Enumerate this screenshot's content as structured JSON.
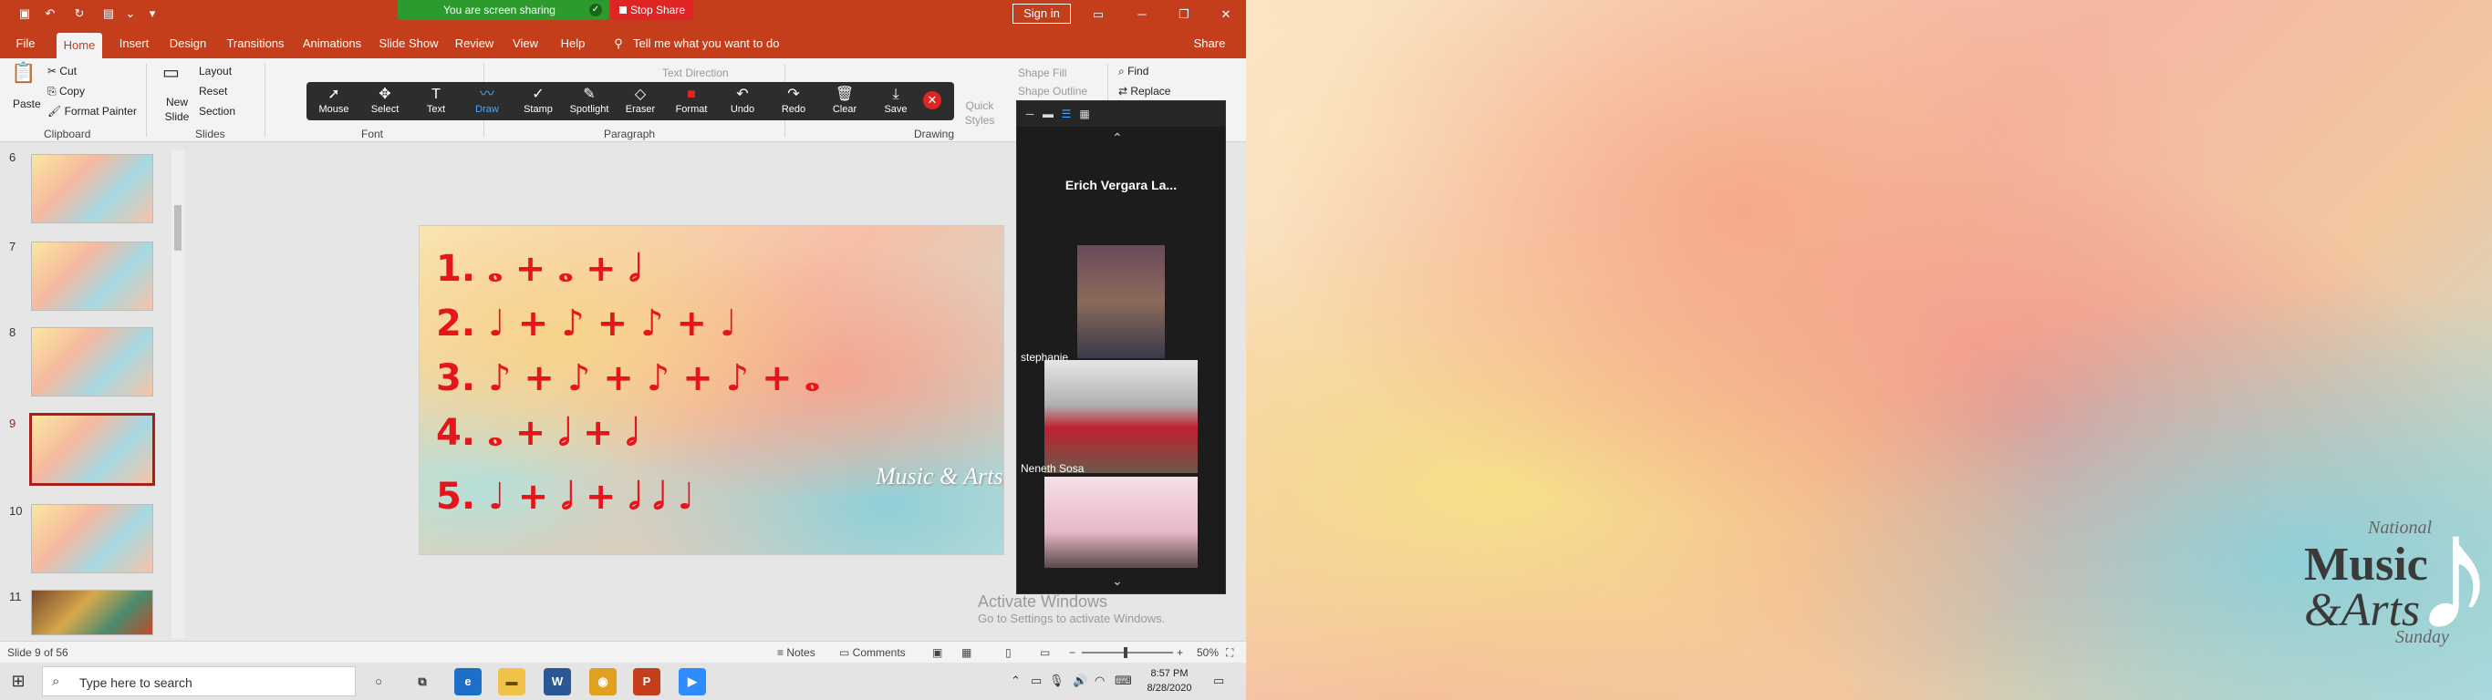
{
  "titlebar": {
    "sharing_text": "You are screen sharing",
    "stop_share": "Stop Share",
    "sign_in": "Sign in"
  },
  "tabs": {
    "file": "File",
    "home": "Home",
    "insert": "Insert",
    "design": "Design",
    "transitions": "Transitions",
    "animations": "Animations",
    "slideshow": "Slide Show",
    "review": "Review",
    "view": "View",
    "help": "Help",
    "tell_me": "Tell me what you want to do",
    "share": "Share"
  },
  "ribbon": {
    "paste": "Paste",
    "cut": "Cut",
    "copy": "Copy",
    "format_painter": "Format Painter",
    "clipboard": "Clipboard",
    "new_slide": "New Slide",
    "layout": "Layout",
    "reset": "Reset",
    "section": "Section",
    "slides": "Slides",
    "font": "Font",
    "paragraph": "Paragraph",
    "drawing": "Drawing",
    "text_direction": "Text Direction",
    "shape_fill": "Shape Fill",
    "shape_outline": "Shape Outline",
    "quick_styles": "Quick Styles",
    "find": "Find",
    "replace": "Replace"
  },
  "annotate": {
    "tools": [
      "Mouse",
      "Select",
      "Text",
      "Draw",
      "Stamp",
      "Spotlight",
      "Eraser",
      "Format",
      "Undo",
      "Redo",
      "Clear",
      "Save"
    ]
  },
  "thumbnails": {
    "numbers": [
      "6",
      "7",
      "8",
      "9",
      "10",
      "11"
    ]
  },
  "slide": {
    "rows": [
      "1.  𝅝 + 𝅝 + 𝅗𝅥",
      "2.  ♩ + ♪ + ♪ + ♩",
      "3.  ♪ + ♪ + ♪ + ♪ + 𝅝",
      "4.  𝅝 + 𝅗𝅥 + 𝅗𝅥",
      "5.  ♩ + 𝅗𝅥 + 𝅗𝅥 𝅗𝅥 ♩"
    ],
    "logo": "Music & Arts"
  },
  "activate": {
    "line1": "Activate Windows",
    "line2": "Go to Settings to activate Windows."
  },
  "zoom": {
    "host_name": "Erich  Vergara La...",
    "participants": [
      "stephanie",
      "Neneth Sosa",
      ""
    ]
  },
  "statusbar": {
    "slide_of": "Slide 9 of 56",
    "notes": "Notes",
    "comments": "Comments",
    "zoom": "50%"
  },
  "taskbar": {
    "search_placeholder": "Type here to search",
    "time": "8:57 PM",
    "date": "8/28/2020"
  },
  "right_logo": {
    "national": "National",
    "music": "Music",
    "arts": "&Arts",
    "sunday": "Sunday"
  },
  "colors": {
    "ppt_accent": "#c43e1c",
    "annotation_red": "#e8141b",
    "sharing_green": "#2d9a2d",
    "stop_red": "#e02424"
  }
}
